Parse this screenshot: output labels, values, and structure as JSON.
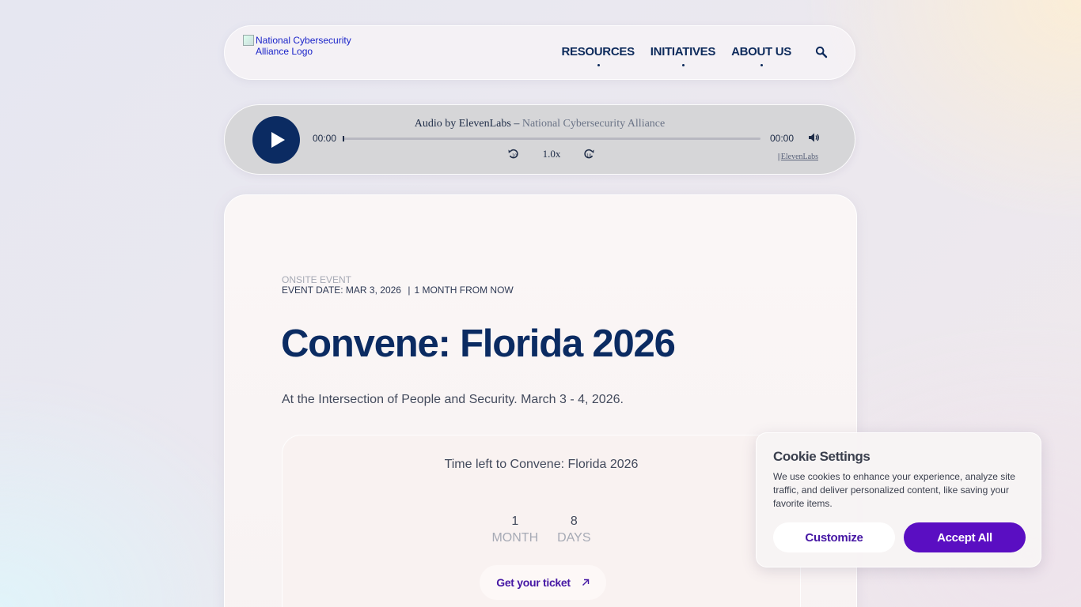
{
  "header": {
    "logo_alt": "National Cybersecurity Alliance Logo",
    "nav": [
      {
        "label": "RESOURCES"
      },
      {
        "label": "INITIATIVES"
      },
      {
        "label": "ABOUT US"
      }
    ],
    "search_icon": "search-icon"
  },
  "audio_player": {
    "title": "Audio by ElevenLabs",
    "separator": "–",
    "subtitle": "National Cybersecurity Alliance",
    "current_time": "00:00",
    "total_time": "00:00",
    "progress": 0,
    "speed": "1.0x",
    "brand_link": "||ElevenLabs",
    "icons": [
      "play-icon",
      "rewind-icon",
      "forward-icon",
      "volume-icon"
    ]
  },
  "event": {
    "type": "ONSITE EVENT",
    "date_label": "EVENT DATE:",
    "date_value": "MAR 3, 2026",
    "date_sep": "|",
    "relative": "1 MONTH FROM NOW",
    "title": "Convene: Florida 2026",
    "subtitle": "At the Intersection of People and Security. March 3 - 4, 2026."
  },
  "countdown": {
    "title": "Time left to Convene: Florida 2026",
    "units": [
      {
        "value": "1",
        "label": "MONTH"
      },
      {
        "value": "8",
        "label": "DAYS"
      }
    ],
    "ticket_label": "Get your ticket"
  },
  "cookie": {
    "title": "Cookie Settings",
    "text": "We use cookies to enhance your experience, analyze site traffic, and deliver personalized content, like saving your favorite items.",
    "customize_label": "Customize",
    "accept_label": "Accept All"
  },
  "colors": {
    "navy": "#0b2b62",
    "purple": "#5a0ec2",
    "purple_text": "#4617a4",
    "muted": "#a6aab5"
  }
}
